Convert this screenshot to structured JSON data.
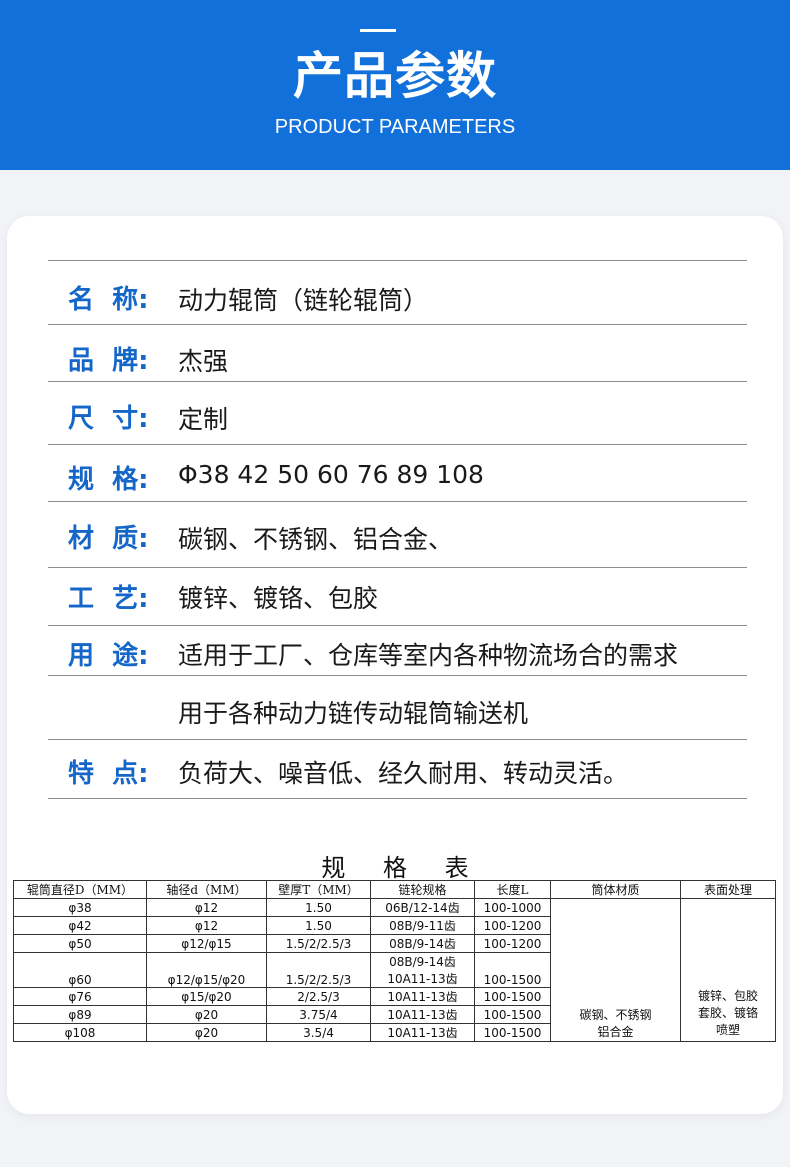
{
  "header": {
    "title": "产品参数",
    "subtitle": "PRODUCT PARAMETERS"
  },
  "params": [
    {
      "label": "名  称:",
      "value": "动力辊筒（链轮辊筒）"
    },
    {
      "label": "品  牌:",
      "value": "杰强"
    },
    {
      "label": "尺  寸:",
      "value": "定制"
    },
    {
      "label": "规  格:",
      "value": "Φ38 42 50 60 76 89 108"
    },
    {
      "label": "材  质:",
      "value": "碳钢、不锈钢、铝合金、"
    },
    {
      "label": "工  艺:",
      "value": "镀锌、镀铬、包胶"
    },
    {
      "label": "用  途:",
      "value": "适用于工厂、仓库等室内各种物流场合的需求",
      "value2": "用于各种动力链传动辊筒输送机"
    },
    {
      "label": "特  点:",
      "value": "负荷大、噪音低、经久耐用、转动灵活。"
    }
  ],
  "spec_table": {
    "title": "规 格 表",
    "headers": [
      "辊筒直径D（MM）",
      "轴径d（MM）",
      "壁厚T（MM）",
      "链轮规格",
      "长度L",
      "筒体材质",
      "表面处理"
    ],
    "rows": [
      {
        "d": "φ38",
        "shaft": "φ12",
        "wall": "1.50",
        "chain": "06B/12-14齿",
        "len": "100-1000"
      },
      {
        "d": "φ42",
        "shaft": "φ12",
        "wall": "1.50",
        "chain": "08B/9-11齿",
        "len": "100-1200"
      },
      {
        "d": "φ50",
        "shaft": "φ12/φ15",
        "wall": "1.5/2/2.5/3",
        "chain": "08B/9-14齿",
        "len": "100-1200"
      },
      {
        "d": "φ60",
        "shaft": "φ12/φ15/φ20",
        "wall": "1.5/2/2.5/3",
        "chain": "08B/9-14齿",
        "chain2": "10A11-13齿",
        "len": "100-1500"
      },
      {
        "d": "φ76",
        "shaft": "φ15/φ20",
        "wall": "2/2.5/3",
        "chain": "10A11-13齿",
        "len": "100-1500"
      },
      {
        "d": "φ89",
        "shaft": "φ20",
        "wall": "3.75/4",
        "chain": "10A11-13齿",
        "len": "100-1500"
      },
      {
        "d": "φ108",
        "shaft": "φ20",
        "wall": "3.5/4",
        "chain": "10A11-13齿",
        "len": "100-1500"
      }
    ],
    "material_line1": "碳钢、不锈钢",
    "material_line2": "铝合金",
    "surface_line1": "镀锌、包胶",
    "surface_line2": "套胶、镀铬",
    "surface_line3": "喷塑"
  }
}
